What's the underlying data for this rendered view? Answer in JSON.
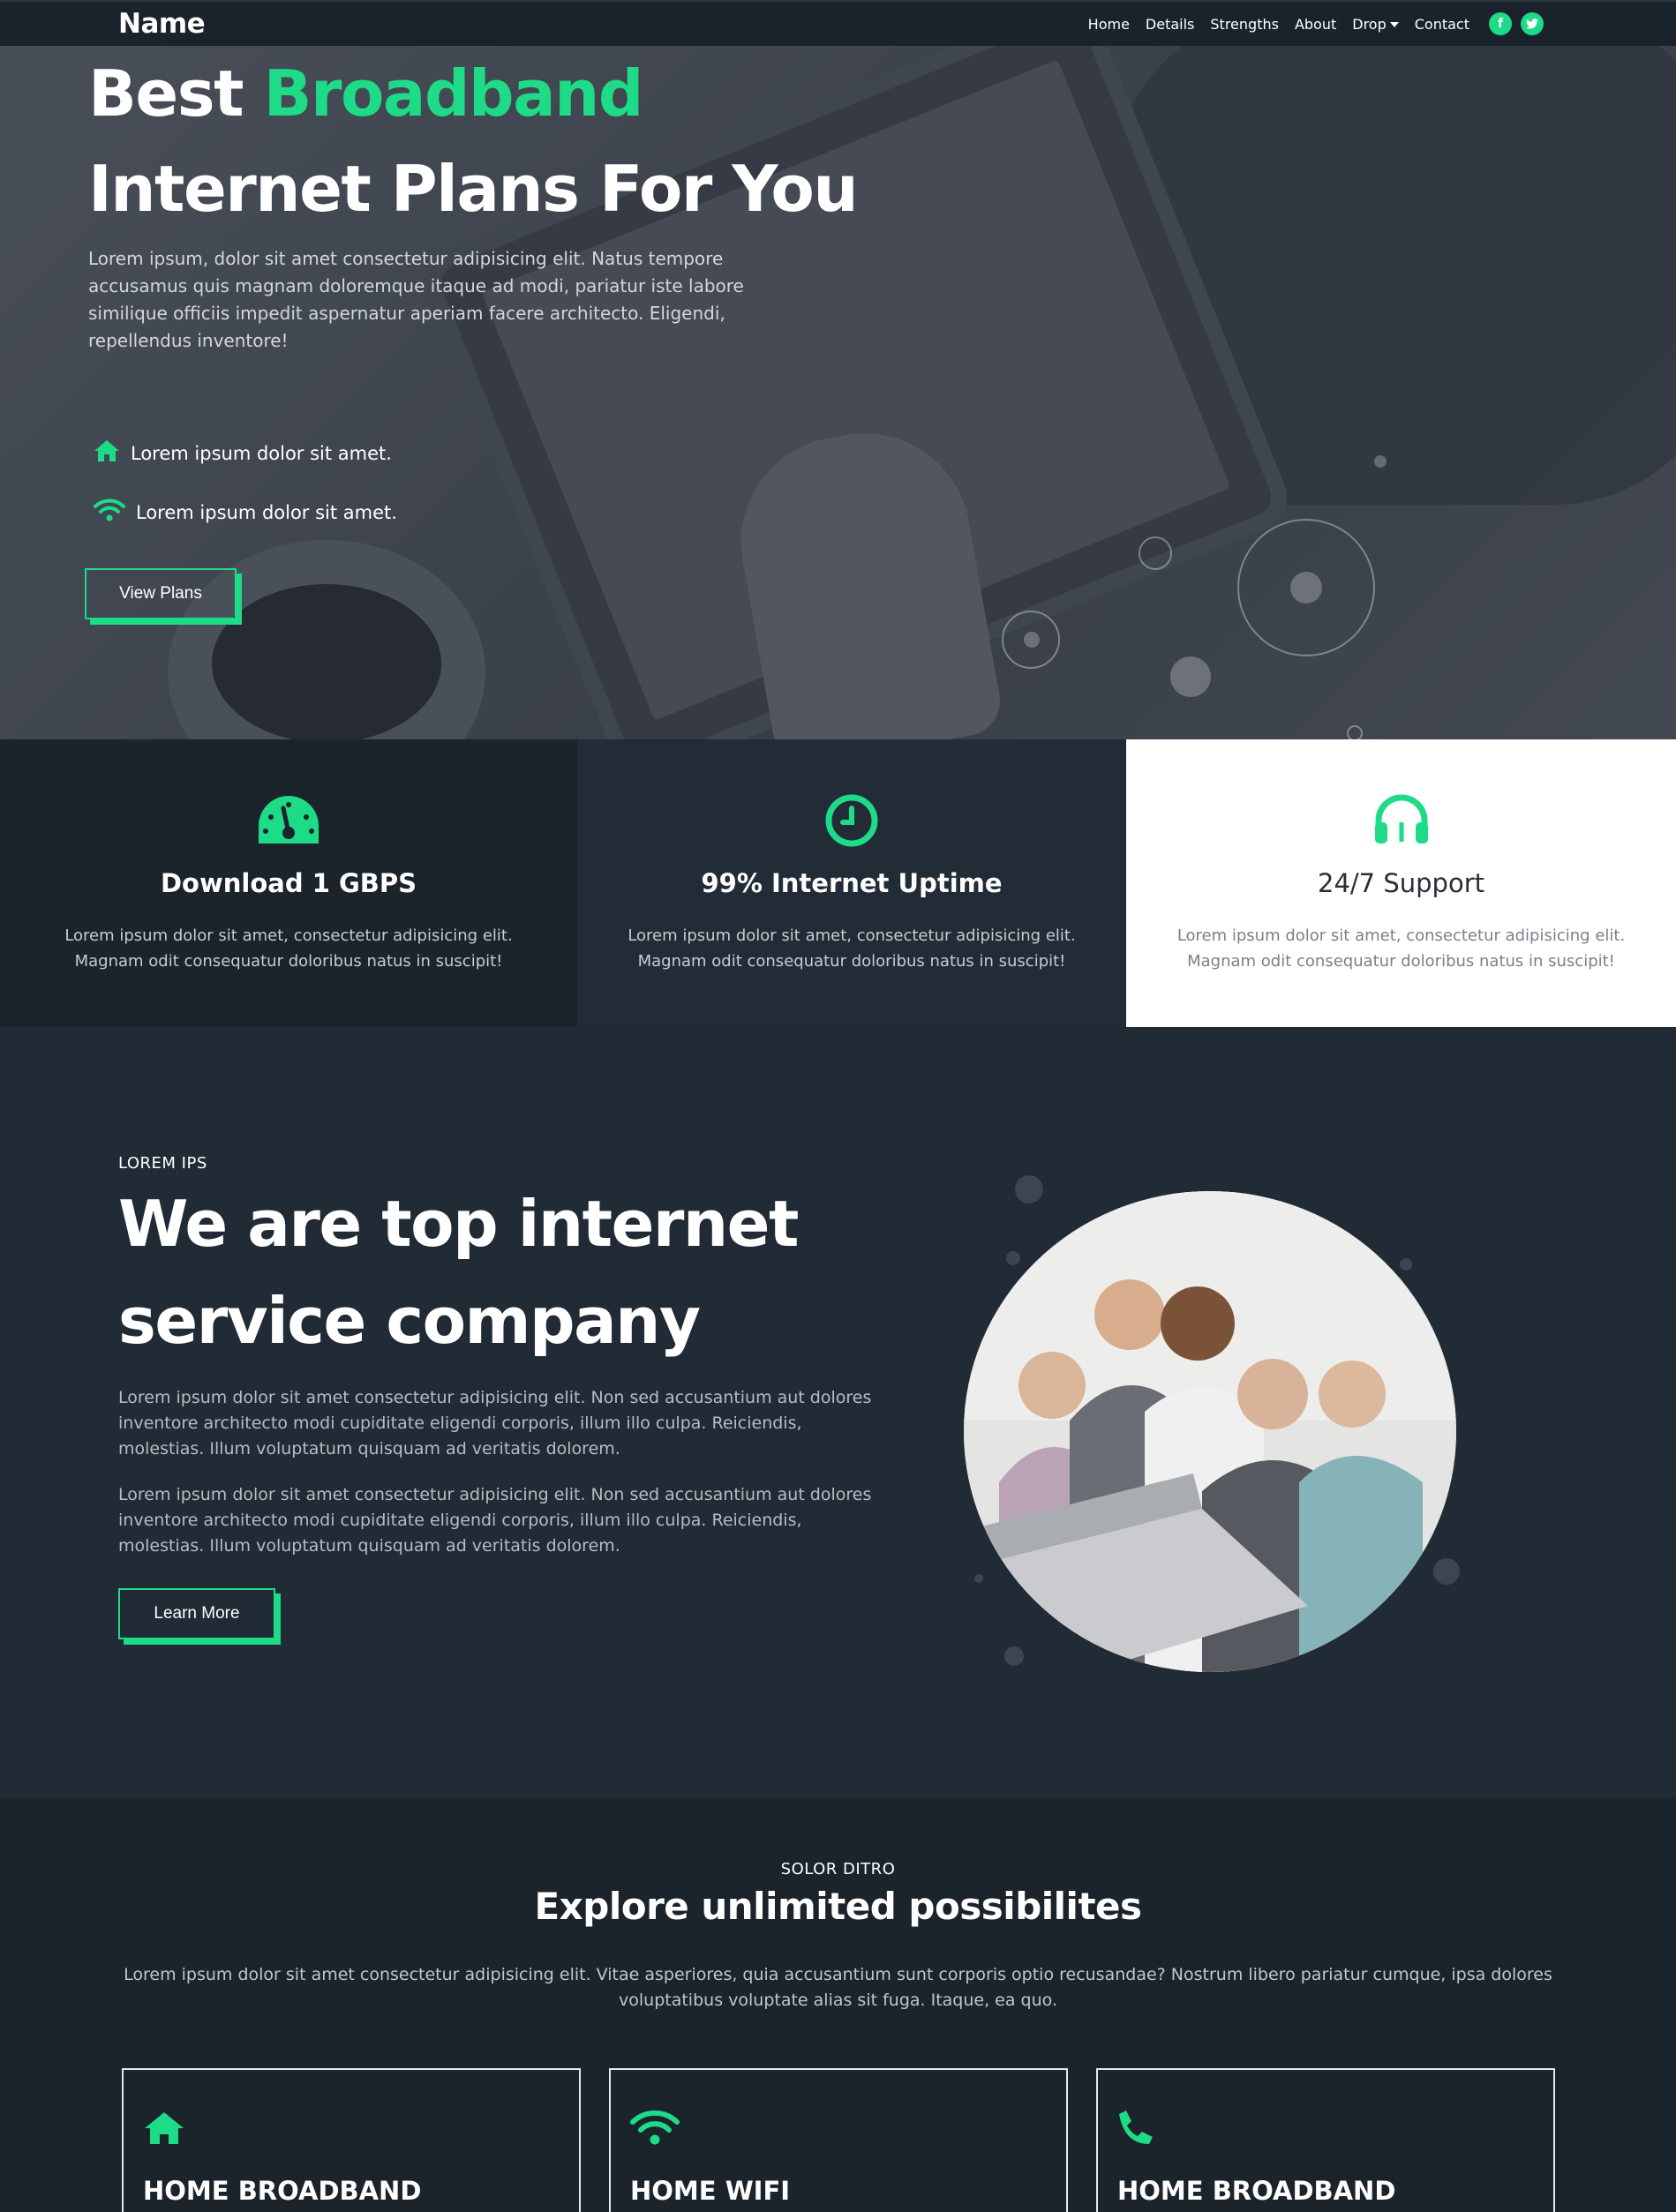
{
  "colors": {
    "accent": "#1ddb87",
    "dark": "#1c242c",
    "darker": "#1a232b",
    "white": "#ffffff"
  },
  "navbar": {
    "brand": "Name",
    "links": [
      "Home",
      "Details",
      "Strengths",
      "About",
      "Drop",
      "Contact"
    ],
    "social": [
      {
        "icon": "facebook-icon",
        "glyph": "f"
      },
      {
        "icon": "twitter-icon",
        "glyph": "t"
      }
    ]
  },
  "hero": {
    "title_part1": "Best ",
    "title_accent": "Broadband",
    "title_line2": "Internet Plans For You",
    "text": "Lorem ipsum, dolor sit amet consectetur adipisicing elit. Natus tempore accusamus quis magnam doloremque itaque ad modi, pariatur iste labore similique officiis impedit aspernatur aperiam facere architecto. Eligendi, repellendus inventore!",
    "features": [
      {
        "icon": "home-icon",
        "label": "Lorem ipsum dolor sit amet."
      },
      {
        "icon": "wifi-icon",
        "label": "Lorem ipsum dolor sit amet."
      }
    ],
    "button": "View Plans"
  },
  "features": [
    {
      "icon": "speedometer-icon",
      "title": "Download 1 GBPS",
      "text": "Lorem ipsum dolor sit amet, consectetur adipisicing elit. Magnam odit consequatur doloribus natus in suscipit!"
    },
    {
      "icon": "clock-icon",
      "title": "99% Internet Uptime",
      "text": "Lorem ipsum dolor sit amet, consectetur adipisicing elit. Magnam odit consequatur doloribus natus in suscipit!"
    },
    {
      "icon": "headphones-icon",
      "title": "24/7 Support",
      "text": "Lorem ipsum dolor sit amet, consectetur adipisicing elit. Magnam odit consequatur doloribus natus in suscipit!"
    }
  ],
  "about": {
    "eyebrow": "LOREM IPS",
    "title_line1": "We are top internet",
    "title_line2": "service company",
    "paragraphs": [
      "Lorem ipsum dolor sit amet consectetur adipisicing elit. Non sed accusantium aut dolores inventore architecto modi cupiditate eligendi corporis, illum illo culpa. Reiciendis, molestias. Illum voluptatum quisquam ad veritatis dolorem.",
      "Lorem ipsum dolor sit amet consectetur adipisicing elit. Non sed accusantium aut dolores inventore architecto modi cupiditate eligendi corporis, illum illo culpa. Reiciendis, molestias. Illum voluptatum quisquam ad veritatis dolorem."
    ],
    "button": "Learn More"
  },
  "services": {
    "eyebrow": "SOLOR DITRO",
    "title": "Explore unlimited possibilites",
    "text": "Lorem ipsum dolor sit amet consectetur adipisicing elit. Vitae asperiores, quia accusantium sunt corporis optio recusandae? Nostrum libero pariatur cumque, ipsa dolores voluptatibus voluptate alias sit fuga. Itaque, ea quo.",
    "cards": [
      {
        "icon": "home-icon",
        "title": "HOME BROADBAND"
      },
      {
        "icon": "wifi-icon",
        "title": "HOME WIFI"
      },
      {
        "icon": "phone-icon",
        "title": "HOME BROADBAND"
      }
    ]
  }
}
